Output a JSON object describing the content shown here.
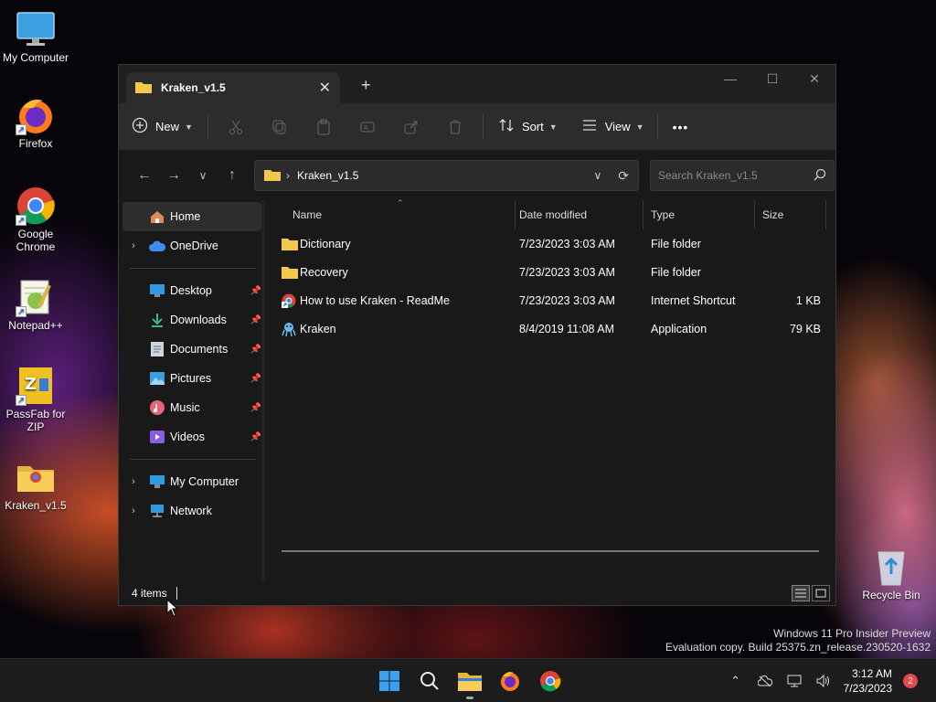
{
  "desktop": {
    "icons": [
      {
        "label": "My Computer",
        "icon": "monitor-icon"
      },
      {
        "label": "Firefox",
        "icon": "firefox-icon"
      },
      {
        "label": "Google Chrome",
        "icon": "chrome-icon"
      },
      {
        "label": "Notepad++",
        "icon": "notepadpp-icon"
      },
      {
        "label": "PassFab for ZIP",
        "icon": "passfab-icon"
      },
      {
        "label": "Kraken_v1.5",
        "icon": "folder-icon"
      },
      {
        "label": "Recycle Bin",
        "icon": "recycle-bin-icon"
      }
    ],
    "watermark_line1": "Windows 11 Pro Insider Preview",
    "watermark_line2": "Evaluation copy. Build 25375.zn_release.230520-1632"
  },
  "window": {
    "tab_title": "Kraken_v1.5",
    "minimize": "—",
    "maximize": "☐",
    "close": "✕"
  },
  "toolbar": {
    "new_label": "New",
    "sort_label": "Sort",
    "view_label": "View",
    "more_label": "•••"
  },
  "address": {
    "path": "Kraken_v1.5",
    "search_placeholder": "Search Kraken_v1.5"
  },
  "sidebar": {
    "home": "Home",
    "onedrive": "OneDrive",
    "quick": [
      {
        "label": "Desktop",
        "icon": "desktop-icon"
      },
      {
        "label": "Downloads",
        "icon": "download-icon"
      },
      {
        "label": "Documents",
        "icon": "documents-icon"
      },
      {
        "label": "Pictures",
        "icon": "pictures-icon"
      },
      {
        "label": "Music",
        "icon": "music-icon"
      },
      {
        "label": "Videos",
        "icon": "videos-icon"
      }
    ],
    "mycomputer": "My Computer",
    "network": "Network"
  },
  "columns": {
    "name": "Name",
    "date": "Date modified",
    "type": "Type",
    "size": "Size"
  },
  "files": [
    {
      "name": "Dictionary",
      "date": "7/23/2023 3:03 AM",
      "type": "File folder",
      "size": "",
      "icon": "folder-icon"
    },
    {
      "name": "Recovery",
      "date": "7/23/2023 3:03 AM",
      "type": "File folder",
      "size": "",
      "icon": "folder-icon"
    },
    {
      "name": "How to use Kraken - ReadMe",
      "date": "7/23/2023 3:03 AM",
      "type": "Internet Shortcut",
      "size": "1 KB",
      "icon": "internet-shortcut-icon"
    },
    {
      "name": "Kraken",
      "date": "8/4/2019 11:08 AM",
      "type": "Application",
      "size": "79 KB",
      "icon": "kraken-app-icon"
    }
  ],
  "status": {
    "items": "4 items"
  },
  "taskbar": {
    "time": "3:12 AM",
    "date": "7/23/2023",
    "notifications": "2"
  },
  "colors": {
    "folder": "#f2c94c",
    "accent": "#3c8ef0"
  }
}
